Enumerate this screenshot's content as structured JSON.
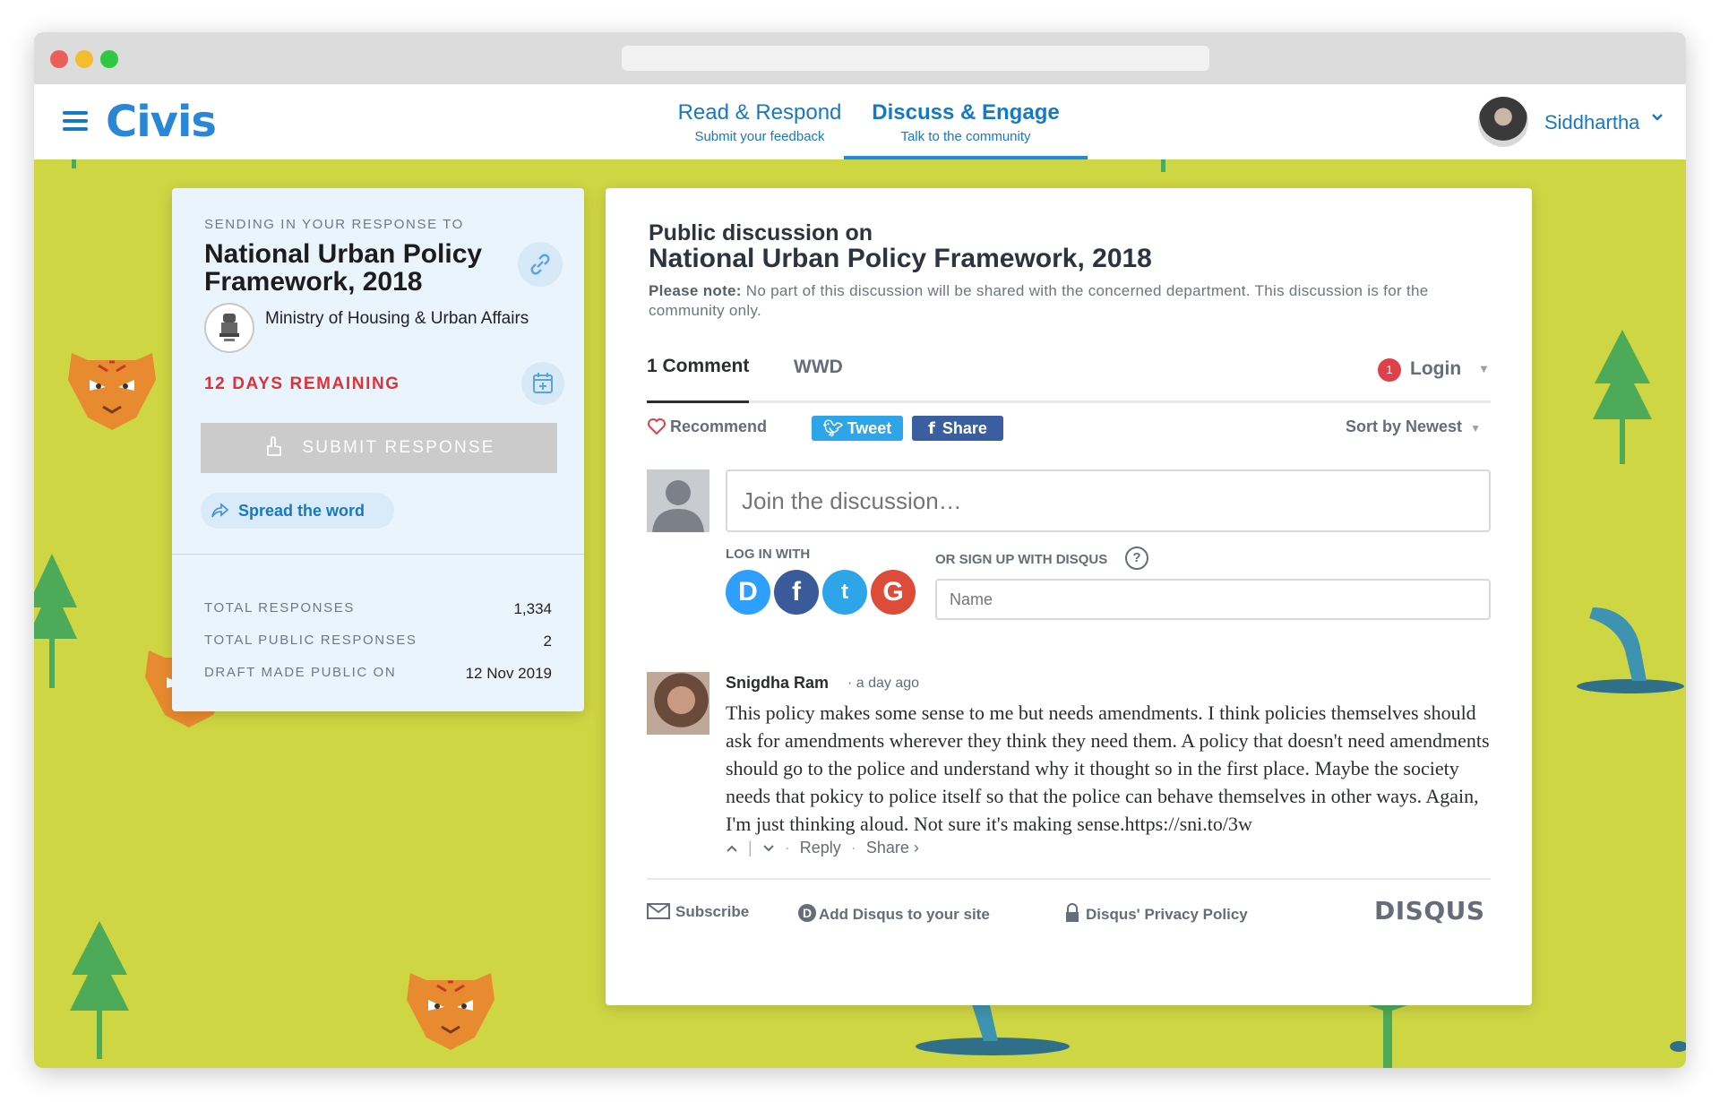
{
  "browser": {
    "dot_colors": [
      "#ec5f57",
      "#f4bd2f",
      "#2fc840"
    ]
  },
  "app": {
    "logo": "Civis",
    "nav": [
      {
        "title": "Read & Respond",
        "subtitle": "Submit your feedback",
        "active": false
      },
      {
        "title": "Discuss & Engage",
        "subtitle": "Talk to the community",
        "active": true
      }
    ],
    "user": {
      "name": "Siddhartha"
    },
    "accent_color": "#1779c4",
    "background_color": "#cfd643"
  },
  "left_card": {
    "label": "SENDING IN YOUR RESPONSE TO",
    "title": "National Urban Policy Framework, 2018",
    "ministry": "Ministry of Housing & Urban Affairs",
    "days_remaining": "12 DAYS REMAINING",
    "submit_label": "SUBMIT RESPONSE",
    "spread_label": "Spread the word",
    "stats": [
      {
        "key": "TOTAL RESPONSES",
        "value": "1,334"
      },
      {
        "key": "TOTAL PUBLIC RESPONSES",
        "value": "2"
      },
      {
        "key": "DRAFT MADE PUBLIC ON",
        "value": "12 Nov 2019"
      }
    ]
  },
  "discussion": {
    "heading_small": "Public discussion on",
    "heading_large": "National Urban Policy Framework, 2018",
    "note_bold": "Please note:",
    "note_text": "No part of this discussion will be shared with the concerned department. This discussion is for the community only.",
    "tabs": {
      "comments": "1 Comment",
      "community": "WWD"
    },
    "login": {
      "badge": "1",
      "label": "Login"
    },
    "recommend": "Recommend",
    "tweet": "Tweet",
    "share": "Share",
    "sort": "Sort by Newest",
    "join_placeholder": "Join the discussion…",
    "log_in_with": "LOG IN WITH",
    "sign_up_with": "OR SIGN UP WITH DISQUS",
    "help": "?",
    "social": [
      {
        "letter": "D",
        "color": "#2e9fff"
      },
      {
        "letter": "f",
        "color": "#3b5a99"
      },
      {
        "letter": "t",
        "color": "#2ea5e8"
      },
      {
        "letter": "G",
        "color": "#dd4b39"
      }
    ],
    "name_placeholder": "Name",
    "comment": {
      "author": "Snigdha Ram",
      "time": "· a day ago",
      "body": "This policy makes some sense to me but needs amendments. I think policies themselves should ask for amendments wherever they think they need them. A policy that doesn't need amendments should go to the police and understand why it thought so in the first place. Maybe the society needs that pokicy to police itself so that the police can behave themselves in other ways. Again, I'm just thinking aloud. Not sure it's making sense.https://sni.to/3w",
      "reply": "Reply",
      "share": "Share ›"
    },
    "footer": {
      "subscribe": "Subscribe",
      "add_disqus": "Add Disqus to your site",
      "privacy": "Disqus' Privacy Policy",
      "brand": "DISQUS"
    }
  }
}
